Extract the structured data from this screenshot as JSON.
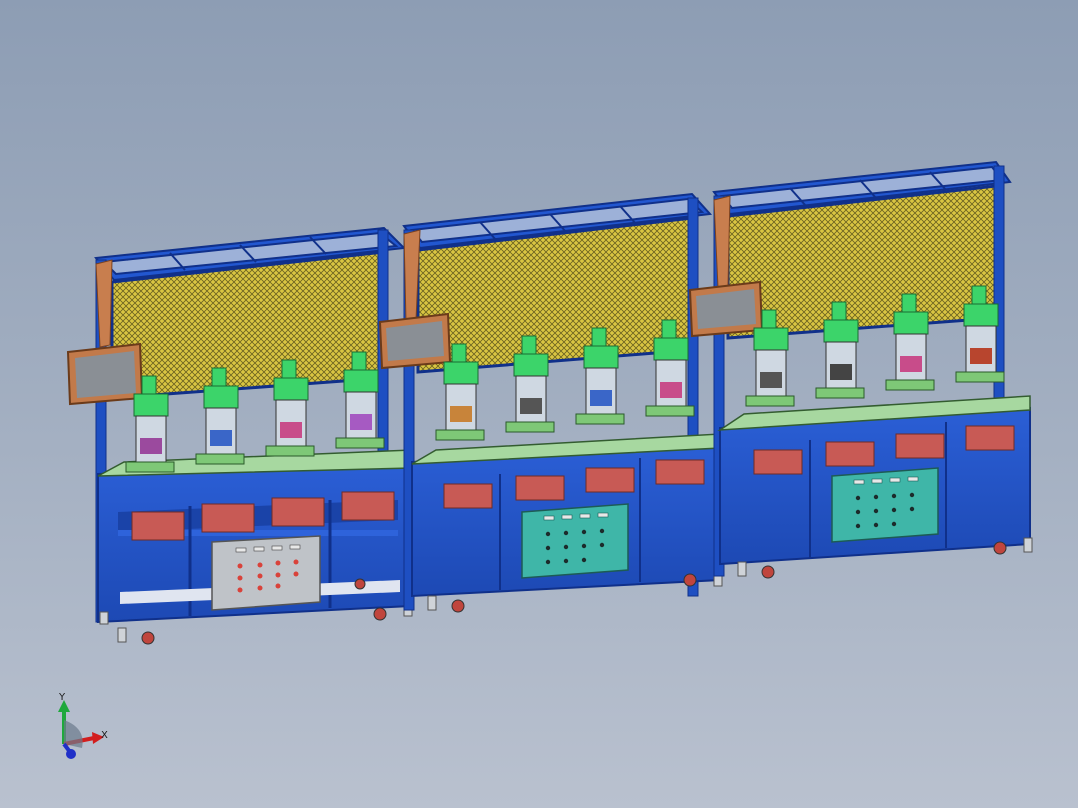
{
  "triad": {
    "x_label": "X",
    "y_label": "Y"
  },
  "colors": {
    "background_top": "#8d9db4",
    "background_bottom": "#b9c1cf",
    "frame_blue": "#1e4fc2",
    "frame_dark": "#10308a",
    "mesh_yellow": "#d9c542",
    "press_green": "#3cd46a",
    "drawer_red": "#c85a55",
    "control_panel_grey": "#bfc3c8",
    "control_panel_teal": "#3fb6a8",
    "monitor_frame": "#c27a4a",
    "monitor_screen": "#8a8f95",
    "arm_brown": "#c87e4e",
    "axis_x": "#d21e1e",
    "axis_y": "#1fa83c",
    "axis_z": "#2030c8"
  },
  "icons": [
    "coordinate-triad-icon"
  ]
}
